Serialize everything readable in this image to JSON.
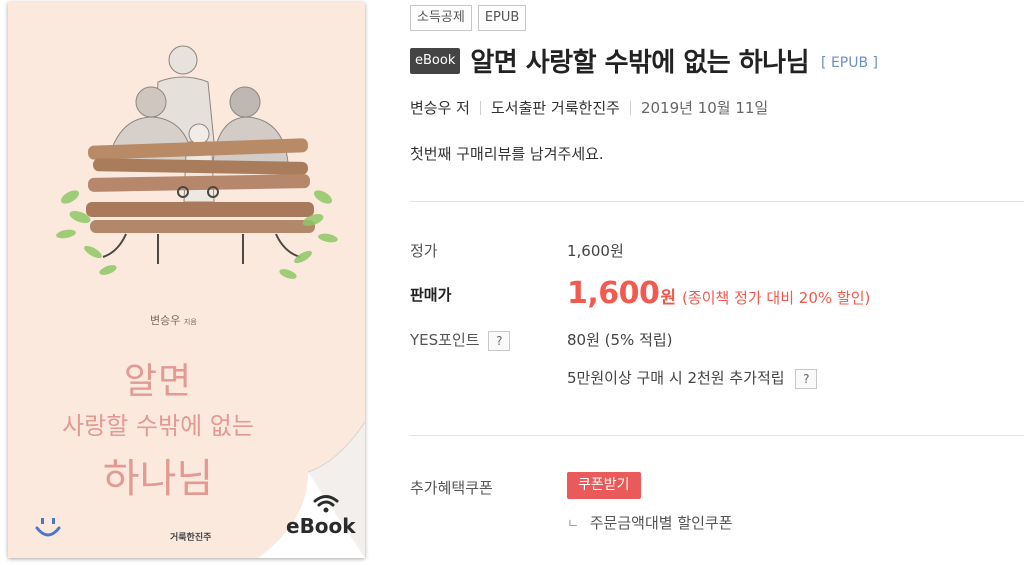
{
  "cover": {
    "author_line": "변승우",
    "author_suffix": "지음",
    "title_line1": "알면",
    "title_line2": "사랑할 수밖에 없는",
    "title_line3": "하나님",
    "publisher": "거룩한진주",
    "ebook_mark": "eBook"
  },
  "tags": [
    "소득공제",
    "EPUB"
  ],
  "product": {
    "badge": "eBook",
    "title": "알면 사랑할 수밖에 없는 하나님",
    "format": "[ EPUB ]",
    "author": "변승우 저",
    "publisher": "도서출판 거룩한진주",
    "date": "2019년 10월 11일",
    "review_prompt": "첫번째 구매리뷰를 남겨주세요."
  },
  "price": {
    "list_label": "정가",
    "list_value": "1,600원",
    "sale_label": "판매가",
    "sale_number": "1,600",
    "sale_unit": "원",
    "sale_discount": "(종이책 정가 대비 20% 할인)",
    "points_label": "YES포인트",
    "points_value": "80원 (5% 적립)",
    "points_extra": "5만원이상 구매 시 2천원 추가적립",
    "help_mark": "?"
  },
  "coupon": {
    "label": "추가혜택쿠폰",
    "button": "쿠폰받기",
    "note_corner": "ㄴ",
    "note": "주문금액대별 할인쿠폰"
  },
  "colors": {
    "accent_red": "#f05a4f",
    "coupon_button": "#ea5a5a",
    "link_blue": "#6b8fc5",
    "badge_dark": "#444444",
    "cover_background": "#fbe9de"
  },
  "icons": [
    "help-icon",
    "wifi-icon",
    "smile-icon"
  ]
}
